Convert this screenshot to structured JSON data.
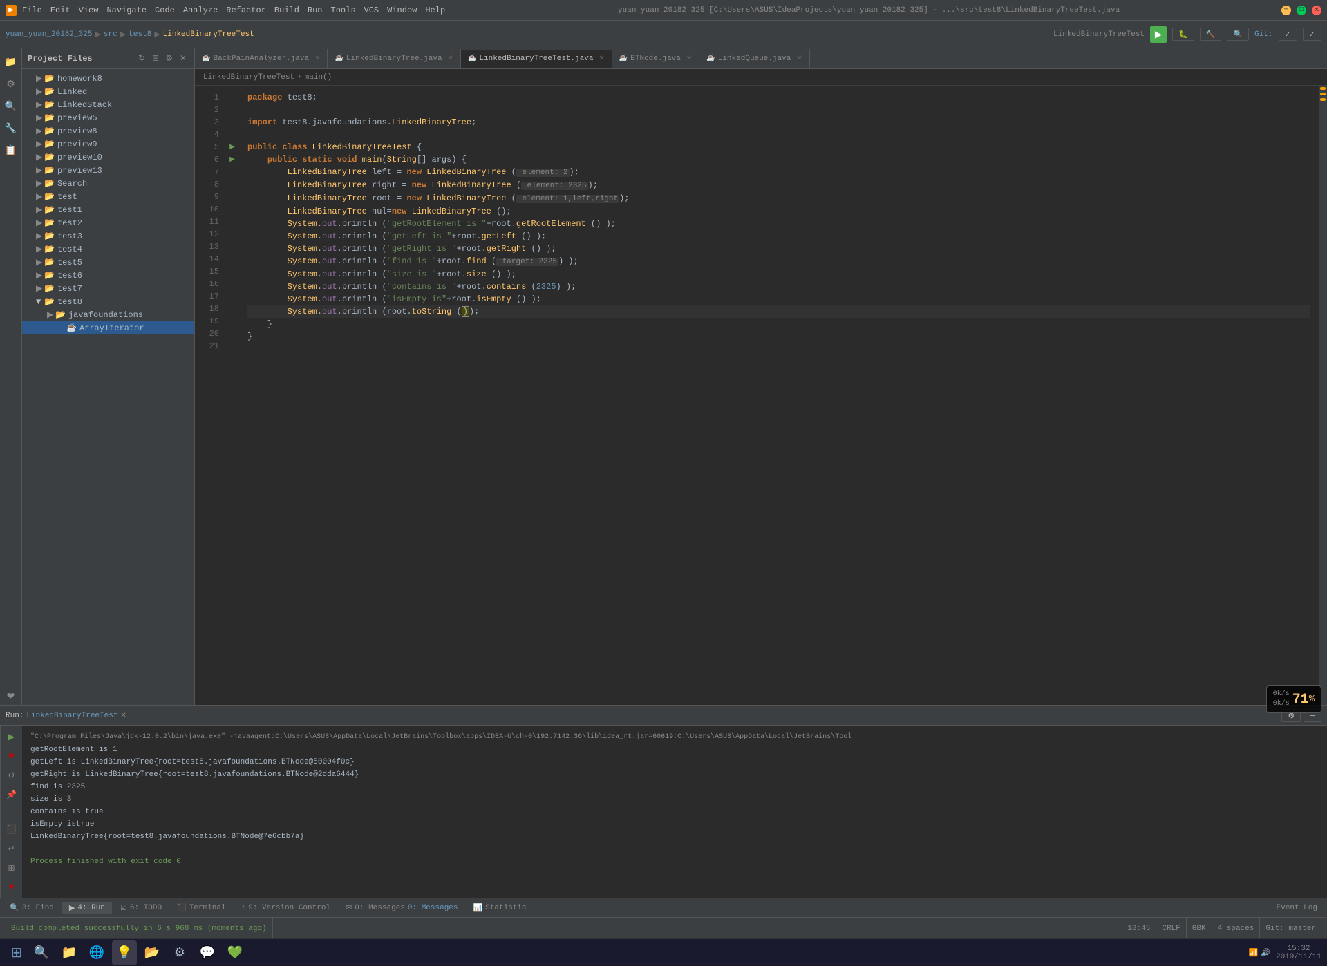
{
  "titleBar": {
    "appName": "yuan_yuan_20182_325",
    "path": "C:\\Users\\ASUS\\IdeaProjects\\yuan_yuan_20182_325",
    "filePath": "...\\src\\test8\\LinkedBinaryTreeTest.java",
    "fullTitle": "yuan_yuan_20182_325 [C:\\Users\\ASUS\\IdeaProjects\\yuan_yuan_20182_325] - ...\\src\\test8\\LinkedBinaryTreeTest.java",
    "menuItems": [
      "File",
      "Edit",
      "View",
      "Navigate",
      "Code",
      "Analyze",
      "Refactor",
      "Build",
      "Run",
      "Tools",
      "VCS",
      "Window",
      "Help"
    ],
    "winControls": [
      "─",
      "□",
      "✕"
    ]
  },
  "toolbar": {
    "breadcrumbs": [
      "yuan_yuan_20182_325",
      "src",
      "test8",
      "LinkedBinaryTreeTest"
    ],
    "breadcrumbSeps": [
      "▶",
      "▶",
      "▶"
    ],
    "runConfig": "LinkedBinaryTreeTest",
    "gitLabel": "Git:"
  },
  "fileTree": {
    "title": "Project Files",
    "items": [
      {
        "label": "homework8",
        "type": "folder",
        "indent": 1,
        "expanded": false
      },
      {
        "label": "Linked",
        "type": "folder",
        "indent": 1,
        "expanded": false
      },
      {
        "label": "LinkedStack",
        "type": "folder",
        "indent": 1,
        "expanded": false
      },
      {
        "label": "preview5",
        "type": "folder",
        "indent": 1,
        "expanded": false
      },
      {
        "label": "preview8",
        "type": "folder",
        "indent": 1,
        "expanded": false
      },
      {
        "label": "preview9",
        "type": "folder",
        "indent": 1,
        "expanded": false
      },
      {
        "label": "preview10",
        "type": "folder",
        "indent": 1,
        "expanded": false
      },
      {
        "label": "preview13",
        "type": "folder",
        "indent": 1,
        "expanded": false
      },
      {
        "label": "Search",
        "type": "folder",
        "indent": 1,
        "expanded": false
      },
      {
        "label": "test",
        "type": "folder",
        "indent": 1,
        "expanded": false
      },
      {
        "label": "test1",
        "type": "folder",
        "indent": 1,
        "expanded": false
      },
      {
        "label": "test2",
        "type": "folder",
        "indent": 1,
        "expanded": false
      },
      {
        "label": "test3",
        "type": "folder",
        "indent": 1,
        "expanded": false
      },
      {
        "label": "test4",
        "type": "folder",
        "indent": 1,
        "expanded": false
      },
      {
        "label": "test5",
        "type": "folder",
        "indent": 1,
        "expanded": false
      },
      {
        "label": "test6",
        "type": "folder",
        "indent": 1,
        "expanded": false
      },
      {
        "label": "test7",
        "type": "folder",
        "indent": 1,
        "expanded": false
      },
      {
        "label": "test8",
        "type": "folder",
        "indent": 1,
        "expanded": true
      },
      {
        "label": "javafoundations",
        "type": "folder",
        "indent": 2,
        "expanded": false
      },
      {
        "label": "ArrayIterator",
        "type": "file-java-green",
        "indent": 3
      }
    ]
  },
  "tabs": [
    {
      "label": "BackPainAnalyzer.java",
      "active": false,
      "modified": false
    },
    {
      "label": "LinkedBinaryTree.java",
      "active": false,
      "modified": false
    },
    {
      "label": "LinkedBinaryTreeTest.java",
      "active": true,
      "modified": false
    },
    {
      "label": "BTNode.java",
      "active": false,
      "modified": false
    },
    {
      "label": "LinkedQueue.java",
      "active": false,
      "modified": false
    }
  ],
  "breadcrumb": {
    "items": [
      "LinkedBinaryTreeTest",
      "main()"
    ]
  },
  "code": {
    "lines": [
      {
        "num": 1,
        "text": "package test8;",
        "markers": []
      },
      {
        "num": 2,
        "text": "",
        "markers": []
      },
      {
        "num": 3,
        "text": "import test8.javafoundations.LinkedBinaryTree;",
        "markers": []
      },
      {
        "num": 4,
        "text": "",
        "markers": []
      },
      {
        "num": 5,
        "text": "public class LinkedBinaryTreeTest {",
        "markers": [
          "run"
        ]
      },
      {
        "num": 6,
        "text": "    public static void main(String[] args) {",
        "markers": [
          "run"
        ]
      },
      {
        "num": 7,
        "text": "        LinkedBinaryTree left = new LinkedBinaryTree ( element: 2);",
        "markers": [],
        "hasHint": true,
        "hint": "element: 2"
      },
      {
        "num": 8,
        "text": "        LinkedBinaryTree right = new LinkedBinaryTree ( element: 2325);",
        "markers": [],
        "hasHint": true,
        "hint": "element: 2325"
      },
      {
        "num": 9,
        "text": "        LinkedBinaryTree root = new LinkedBinaryTree ( element: 1,left,right);",
        "markers": [],
        "hasHint": true,
        "hint": "element: 1,left,right"
      },
      {
        "num": 10,
        "text": "        LinkedBinaryTree nul=new LinkedBinaryTree ();",
        "markers": []
      },
      {
        "num": 11,
        "text": "        System.out.println (\"getRootElement is \"+root.getRootElement () );",
        "markers": []
      },
      {
        "num": 12,
        "text": "        System.out.println (\"getLeft is \"+root.getLeft () );",
        "markers": []
      },
      {
        "num": 13,
        "text": "        System.out.println (\"getRight is \"+root.getRight () );",
        "markers": []
      },
      {
        "num": 14,
        "text": "        System.out.println (\"find is \"+root.find ( target: 2325) );",
        "markers": [],
        "hasHint": true,
        "hint": "target: 2325"
      },
      {
        "num": 15,
        "text": "        System.out.println (\"size is \"+root.size () );",
        "markers": []
      },
      {
        "num": 16,
        "text": "        System.out.println (\"contains is \"+root.contains (2325) );",
        "markers": []
      },
      {
        "num": 17,
        "text": "        System.out.println (\"isEmpty is\"+root.isEmpty () );",
        "markers": []
      },
      {
        "num": 18,
        "text": "        System.out.println (root.toString () );",
        "markers": [
          "current"
        ]
      },
      {
        "num": 19,
        "text": "    }",
        "markers": []
      },
      {
        "num": 20,
        "text": "}",
        "markers": []
      },
      {
        "num": 21,
        "text": "",
        "markers": []
      }
    ]
  },
  "runPanel": {
    "title": "Run:",
    "configName": "LinkedBinaryTreeTest",
    "closeLabel": "✕",
    "output": [
      "\"C:\\Program Files\\Java\\jdk-12.0.2\\bin\\java.exe\" -javaagent:C:\\Users\\ASUS\\AppData\\Local\\JetBrains\\Toolbox\\apps\\IDEA-U\\ch-0\\192.7142.36\\lib\\idea_rt.jar=60619:C:\\Users\\ASUS\\AppData\\Local\\JetBrains\\Tool",
      "getRootElement is 1",
      "getLeft is LinkedBinaryTree{root=test8.javafoundations.BTNode@50004f0c}",
      "getRight is LinkedBinaryTree{root=test8.javafoundations.BTNode@2dda6444}",
      "find is 2325",
      "size is 3",
      "contains is true",
      "isEmpty istrue",
      "LinkedBinaryTree{root=test8.javafoundations.BTNode@7e6cbb7a}",
      "",
      "Process finished with exit code 0"
    ]
  },
  "bottomTabs": [
    {
      "label": "3: Find",
      "icon": "🔍",
      "active": false
    },
    {
      "label": "4: Run",
      "icon": "▶",
      "active": true
    },
    {
      "label": "6: TODO",
      "icon": "☑",
      "active": false
    },
    {
      "label": "Terminal",
      "icon": "⬛",
      "active": false
    },
    {
      "label": "9: Version Control",
      "icon": "↑",
      "active": false
    },
    {
      "label": "0: Messages",
      "icon": "✉",
      "active": false
    },
    {
      "label": "Statistic",
      "icon": "📊",
      "active": false
    }
  ],
  "statusBar": {
    "buildMessage": "Build completed successfully in 6 s 968 ms (moments ago)",
    "time": "18:45",
    "lineEnding": "CRLF",
    "encoding": "GBK",
    "indent": "4 spaces",
    "git": "Git: master",
    "eventLog": "Event Log"
  },
  "cpuWidget": {
    "download": "0k/s",
    "upload": "0k/s",
    "cpuPercent": "71"
  },
  "winTaskbar": {
    "time": "15:32",
    "date": "2019/11/11"
  },
  "sidebarIcons": [
    "📁",
    "⚙",
    "🔍",
    "🔧",
    "📋",
    "🔖",
    "❤",
    "📌"
  ],
  "rightIndicators": [
    "orange",
    "orange",
    "orange"
  ]
}
